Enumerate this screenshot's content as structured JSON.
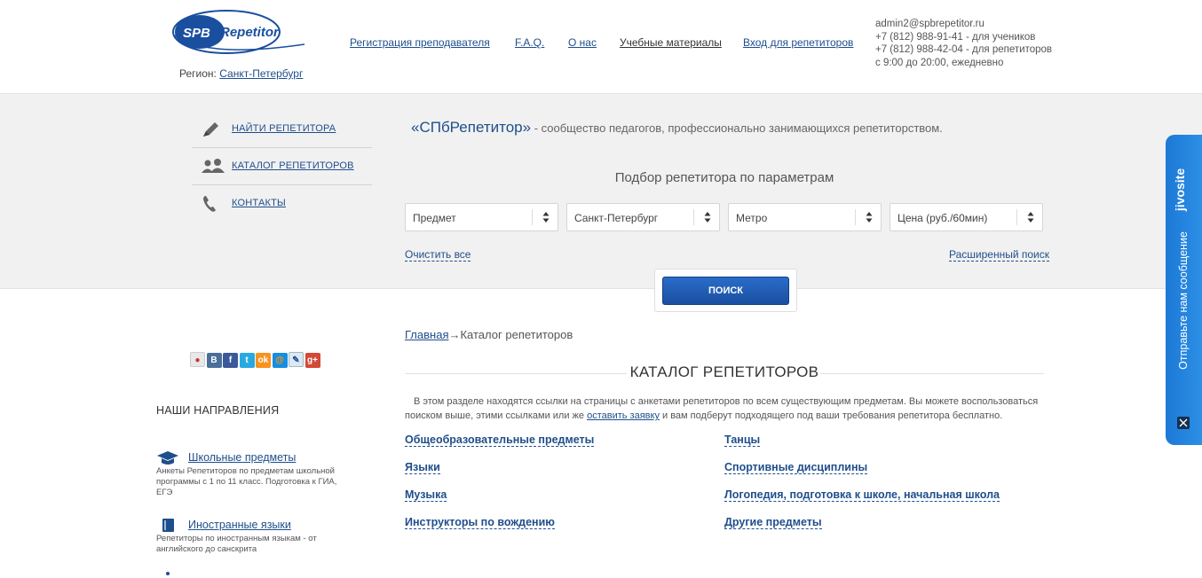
{
  "header": {
    "logo_text": "SPBRepetitor",
    "region_label": "Регион:",
    "region_value": "Санкт-Петербург",
    "nav": [
      "Регистрация преподавателя",
      "F.A.Q.",
      "О нас",
      "Учебные материалы",
      "Вход для репетиторов"
    ],
    "contacts": {
      "email": "admin2@spbrepetitor.ru",
      "phone_students": "+7 (812) 988-91-41 - для учеников",
      "phone_tutors": "+7 (812) 988-42-04 - для репетиторов",
      "hours": "с 9:00 до 20:00, ежедневно"
    }
  },
  "left_menu": [
    {
      "label": "НАЙТИ РЕПЕТИТОРА",
      "icon": "pen-icon"
    },
    {
      "label": "КАТАЛОГ РЕПЕТИТОРОВ",
      "icon": "people-icon"
    },
    {
      "label": "КОНТАКТЫ",
      "icon": "phone-icon"
    }
  ],
  "intro": {
    "brand": "«СПбРепетитор»",
    "text": " - сообщество педагогов, профессионально занимающихся репетиторством."
  },
  "search": {
    "title": "Подбор репетитора по параметрам",
    "selects": [
      "Предмет",
      "Санкт-Петербург",
      "Метро",
      "Цена (руб./60мин)"
    ],
    "clear_all": "Очистить все",
    "advanced": "Расширенный поиск",
    "button": "ПОИСК"
  },
  "social_icons": [
    "bookmark-icon",
    "vk-icon",
    "facebook-icon",
    "twitter-icon",
    "odnoklassniki-icon",
    "mailru-icon",
    "livejournal-icon",
    "googleplus-icon"
  ],
  "directions": {
    "title": "НАШИ НАПРАВЛЕНИЯ",
    "items": [
      {
        "label": "Школьные предметы",
        "desc": "Анкеты Репетиторов по предметам школьной программы с 1 по 11 класс. Подготовка к ГИА, ЕГЭ"
      },
      {
        "label": "Иностранные языки",
        "desc": "Репетиторы по иностранным языкам - от английского до санскрита"
      }
    ]
  },
  "breadcrumb": {
    "home": "Главная",
    "arrow": "→",
    "current": "Каталог репетиторов"
  },
  "catalog": {
    "title": "КАТАЛОГ РЕПЕТИТОРОВ",
    "desc_before": "В этом разделе находятся ссылки на страницы с анкетами репетиторов по всем существующим предметам. Вы можете воспользоваться поиском выше, этими ссылками или же ",
    "desc_link": "оставить заявку",
    "desc_after": " и вам подберут подходящего под ваши требования репетитора бесплатно.",
    "links_left": [
      "Общеобразовательные предметы",
      "Языки",
      "Музыка",
      "Инструкторы по вождению"
    ],
    "links_right": [
      "Танцы",
      "Спортивные дисциплины",
      "Логопедия, подготовка к школе, начальная школа",
      "Другие предметы"
    ]
  },
  "jivo": {
    "brand": "jivosite",
    "message": "Отправьте нам сообщение"
  },
  "colors": {
    "link": "#1f4e8c",
    "button": "#1a4fa0",
    "band": "#f1f1f1",
    "jivo": "#1c79d6"
  }
}
